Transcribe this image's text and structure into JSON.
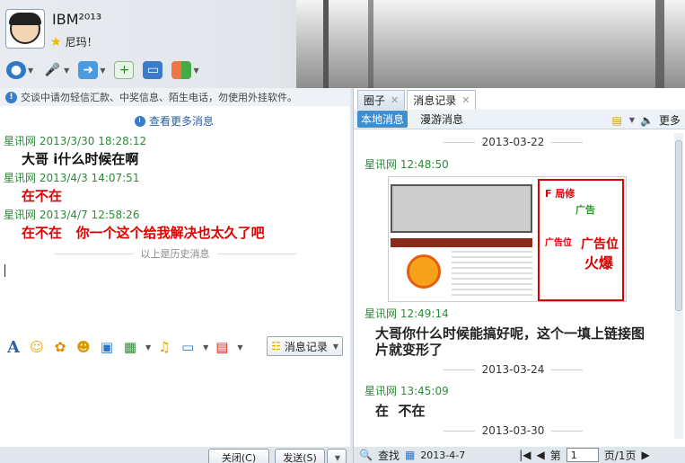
{
  "header": {
    "title": "IBM²⁰¹³",
    "status": "尼玛！"
  },
  "toolbar": {
    "items": [
      "video-call-icon",
      "voice-call-icon",
      "file-transfer-icon",
      "add-app-icon",
      "remote-assist-icon",
      "apps-icon"
    ]
  },
  "left": {
    "notice": "交谈中请勿轻信汇款、中奖信息、陌生电话，勿使用外挂软件。",
    "more_messages": "查看更多消息",
    "messages": [
      {
        "sender": "星讯网",
        "time": "2013/3/30 18:28:12",
        "text": "大哥 i什么时候在啊",
        "color": "#111111"
      },
      {
        "sender": "星讯网",
        "time": "2013/4/3 14:07:51",
        "text": "在不在",
        "color": "#e00000"
      },
      {
        "sender": "星讯网",
        "time": "2013/4/7 12:58:26",
        "text": "在不在   你一个这个给我解决也太久了吧",
        "color": "#e00000"
      }
    ],
    "history_label": "以上是历史消息",
    "history_button": "消息记录",
    "close_button": "关闭(C)",
    "send_button": "发送(S)"
  },
  "right": {
    "tabs": [
      {
        "label": "圈子"
      },
      {
        "label": "消息记录"
      }
    ],
    "subtabs": [
      {
        "label": "本地消息"
      },
      {
        "label": "漫游消息"
      }
    ],
    "more": "更多",
    "dates": [
      "2013-03-22",
      "2013-03-24",
      "2013-03-30"
    ],
    "messages": [
      {
        "sender": "星讯网",
        "time": "12:48:50",
        "text": ""
      },
      {
        "sender": "星讯网",
        "time": "12:49:14",
        "text": "大哥你什么时候能搞好呢，这个一填上链接图片就变形了"
      },
      {
        "sender": "星讯网",
        "time": "13:45:09",
        "text": "在  不在"
      }
    ],
    "bottom": {
      "search": "查找",
      "date": "2013-4-7",
      "page_prefix": "第",
      "page": "1",
      "page_suffix": "页/1页"
    }
  }
}
